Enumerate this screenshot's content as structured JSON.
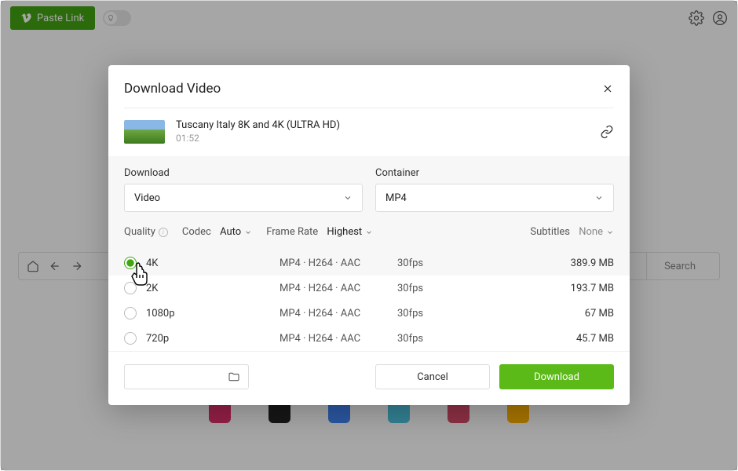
{
  "topbar": {
    "paste_label": "Paste Link",
    "search_label": "Search"
  },
  "modal": {
    "title": "Download Video",
    "video": {
      "title": "Tuscany Italy 8K and 4K (ULTRA HD)",
      "duration": "01:52"
    },
    "download_label": "Download",
    "download_value": "Video",
    "container_label": "Container",
    "container_value": "MP4",
    "quality_label": "Quality",
    "codec_label": "Codec",
    "codec_value": "Auto",
    "framerate_label": "Frame Rate",
    "framerate_value": "Highest",
    "subtitles_label": "Subtitles",
    "subtitles_value": "None",
    "qualities": [
      {
        "name": "4K",
        "codec": "MP4 · H264 · AAC",
        "fps": "30fps",
        "size": "389.9 MB",
        "selected": true
      },
      {
        "name": "2K",
        "codec": "MP4 · H264 · AAC",
        "fps": "30fps",
        "size": "193.7 MB",
        "selected": false
      },
      {
        "name": "1080p",
        "codec": "MP4 · H264 · AAC",
        "fps": "30fps",
        "size": "67 MB",
        "selected": false
      },
      {
        "name": "720p",
        "codec": "MP4 · H264 · AAC",
        "fps": "30fps",
        "size": "45.7 MB",
        "selected": false
      }
    ],
    "cancel_label": "Cancel",
    "download_btn_label": "Download"
  },
  "site_colors": [
    "#e1306c",
    "#222",
    "#4285f4",
    "#4ec3e0",
    "#d84b6a",
    "#ffb300"
  ]
}
